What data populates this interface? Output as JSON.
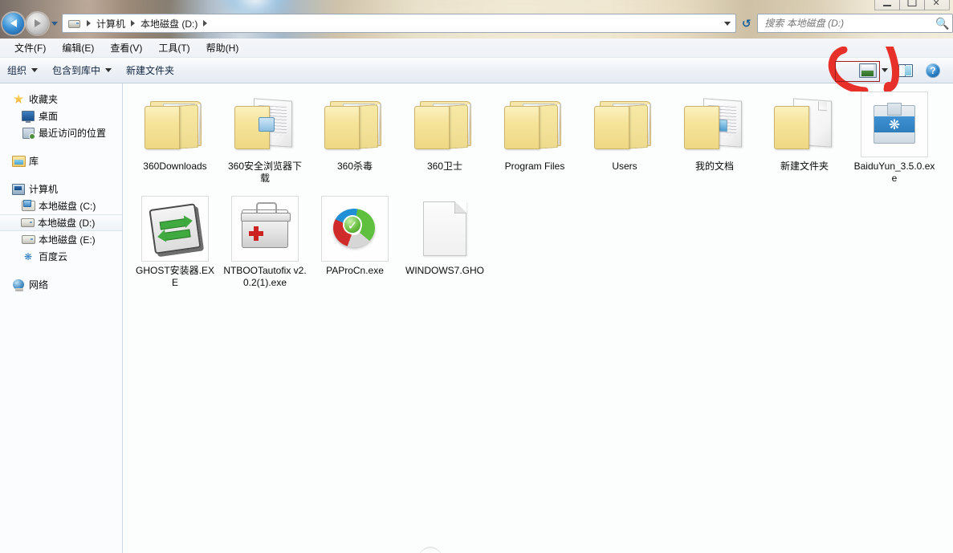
{
  "window": {
    "caption_buttons": [
      {
        "name": "minimize",
        "glyph": "—"
      },
      {
        "name": "maximize",
        "glyph": "❐"
      },
      {
        "name": "close",
        "glyph": "✕"
      }
    ]
  },
  "navigation": {
    "back_tooltip": "后退",
    "forward_tooltip": "前进",
    "history_tooltip": "最近的位置",
    "refresh_glyph": "↺"
  },
  "address": {
    "icon": "drive-icon",
    "crumbs": [
      "计算机",
      "本地磁盘 (D:)"
    ],
    "trailing_separator": true
  },
  "search": {
    "placeholder": "搜索 本地磁盘 (D:)",
    "value": "",
    "icon": "search-icon"
  },
  "menubar": {
    "items": [
      {
        "label": "文件(F)"
      },
      {
        "label": "编辑(E)"
      },
      {
        "label": "查看(V)"
      },
      {
        "label": "工具(T)"
      },
      {
        "label": "帮助(H)"
      }
    ]
  },
  "toolbar": {
    "organize_label": "组织",
    "include_library_label": "包含到库中",
    "new_folder_label": "新建文件夹",
    "views_icon": "views-icon",
    "views_dropdown_icon": "chevron-down-icon",
    "preview_pane_icon": "preview-pane-icon",
    "help_icon": "help-icon",
    "help_glyph": "?"
  },
  "sidebar": {
    "groups": [
      {
        "header": {
          "label": "收藏夹",
          "icon": "star-icon",
          "name": "favorites"
        },
        "items": [
          {
            "label": "桌面",
            "icon": "desktop-icon",
            "name": "desktop",
            "selected": false
          },
          {
            "label": "最近访问的位置",
            "icon": "recent-places-icon",
            "name": "recent-places",
            "selected": false
          }
        ]
      },
      {
        "header": {
          "label": "库",
          "icon": "library-icon",
          "name": "libraries"
        },
        "items": []
      },
      {
        "header": {
          "label": "计算机",
          "icon": "computer-icon",
          "name": "computer"
        },
        "items": [
          {
            "label": "本地磁盘 (C:)",
            "icon": "system-drive-icon",
            "name": "drive-c",
            "selected": false
          },
          {
            "label": "本地磁盘 (D:)",
            "icon": "drive-icon",
            "name": "drive-d",
            "selected": true
          },
          {
            "label": "本地磁盘 (E:)",
            "icon": "drive-icon",
            "name": "drive-e",
            "selected": false
          },
          {
            "label": "百度云",
            "icon": "baidu-cloud-icon",
            "name": "baidu-cloud",
            "selected": false
          }
        ]
      },
      {
        "header": {
          "label": "网络",
          "icon": "network-icon",
          "name": "network"
        },
        "items": []
      }
    ]
  },
  "content": {
    "items": [
      {
        "label": "360Downloads",
        "kind": "folder",
        "icon": "folder-icon",
        "boxed": false
      },
      {
        "label": "360安全浏览器下载",
        "kind": "folder-open",
        "icon": "folder-open-icon",
        "boxed": false
      },
      {
        "label": "360杀毒",
        "kind": "folder",
        "icon": "folder-icon",
        "boxed": false
      },
      {
        "label": "360卫士",
        "kind": "folder",
        "icon": "folder-icon",
        "boxed": false
      },
      {
        "label": "Program Files",
        "kind": "folder",
        "icon": "folder-icon",
        "boxed": false
      },
      {
        "label": "Users",
        "kind": "folder",
        "icon": "folder-icon",
        "boxed": false
      },
      {
        "label": "我的文档",
        "kind": "folder-docs",
        "icon": "folder-documents-icon",
        "boxed": false
      },
      {
        "label": "新建文件夹",
        "kind": "folder-empty",
        "icon": "folder-empty-icon",
        "boxed": false
      },
      {
        "label": "BaiduYun_3.5.0.exe",
        "kind": "baiduyun",
        "icon": "baiduyun-setup-icon",
        "boxed": true
      },
      {
        "label": "GHOST安装器.EXE",
        "kind": "ghost",
        "icon": "ghost-installer-icon",
        "boxed": true
      },
      {
        "label": "NTBOOTautofix v2.0.2(1).exe",
        "kind": "toolbox",
        "icon": "toolbox-icon",
        "boxed": true
      },
      {
        "label": "PAProCn.exe",
        "kind": "pie",
        "icon": "partition-assistant-icon",
        "boxed": true
      },
      {
        "label": "WINDOWS7.GHO",
        "kind": "blankdoc",
        "icon": "blank-document-icon",
        "boxed": false
      }
    ]
  },
  "annotation": {
    "shape": "hand-drawn-arc",
    "color": "#e8302a",
    "highlight_rect_color": "#9e1b1b",
    "targets_button": "views-icon"
  }
}
